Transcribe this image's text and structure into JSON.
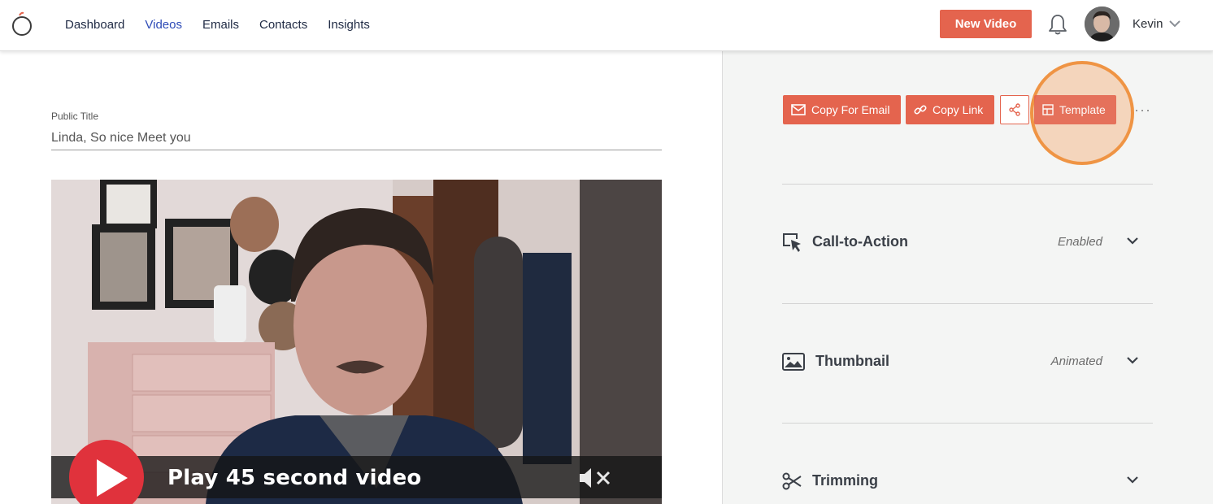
{
  "nav": {
    "items": [
      {
        "label": "Dashboard",
        "active": false
      },
      {
        "label": "Videos",
        "active": true
      },
      {
        "label": "Emails",
        "active": false
      },
      {
        "label": "Contacts",
        "active": false
      },
      {
        "label": "Insights",
        "active": false
      }
    ],
    "new_video_label": "New Video",
    "user_name": "Kevin"
  },
  "editor": {
    "public_title_label": "Public Title",
    "public_title_value": "Linda, So nice Meet you"
  },
  "video": {
    "play_label": "Play 45 second video"
  },
  "actions": {
    "copy_email_label": "Copy For Email",
    "copy_link_label": "Copy Link",
    "template_label": "Template",
    "more_label": "···"
  },
  "sections": [
    {
      "title": "Call-to-Action",
      "status": "Enabled",
      "icon": "cursor-click-icon"
    },
    {
      "title": "Thumbnail",
      "status": "Animated",
      "icon": "image-icon"
    },
    {
      "title": "Trimming",
      "status": "",
      "icon": "scissors-icon"
    }
  ],
  "colors": {
    "accent": "#e4644e",
    "nav_active": "#2d4bb7",
    "highlight_ring": "#ef9444",
    "panel_bg": "#f4f5f4",
    "play_red": "#e0323c"
  }
}
